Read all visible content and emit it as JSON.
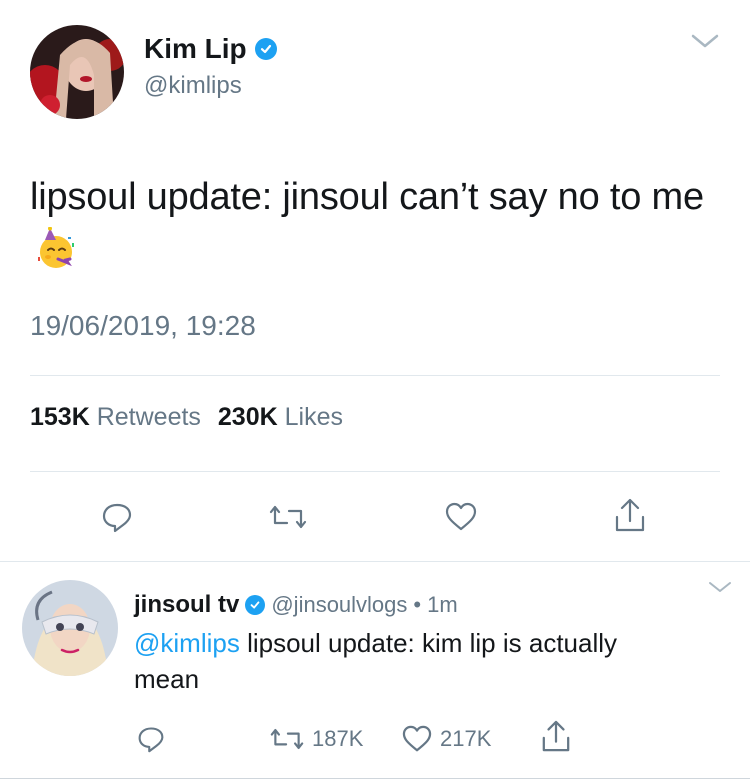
{
  "main_tweet": {
    "author": {
      "name": "Kim Lip",
      "handle": "@kimlips",
      "verified": true,
      "avatar": "avatar-kim-lip"
    },
    "text": "lipsoul update: jinsoul can’t say no to me",
    "emoji": "partying-face-emoji",
    "timestamp": "19/06/2019, 19:28",
    "stats": {
      "retweets_count": "153K",
      "retweets_label": "Retweets",
      "likes_count": "230K",
      "likes_label": "Likes"
    },
    "actions": [
      "reply-icon",
      "retweet-icon",
      "like-icon",
      "share-icon"
    ]
  },
  "reply": {
    "author": {
      "name": "jinsoul tv",
      "handle": "@jinsoulvlogs",
      "verified": true,
      "separator": "•",
      "time": "1m",
      "avatar": "avatar-jinsoul-tv"
    },
    "mention": "@kimlips",
    "text_line1": " lipsoul update: kim lip is actually",
    "text_line2": "mean",
    "actions": {
      "retweet_count": "187K",
      "like_count": "217K"
    }
  },
  "colors": {
    "accent": "#1da1f2",
    "text": "#14171a",
    "secondary": "#657786",
    "divider": "#e1e8ed"
  }
}
